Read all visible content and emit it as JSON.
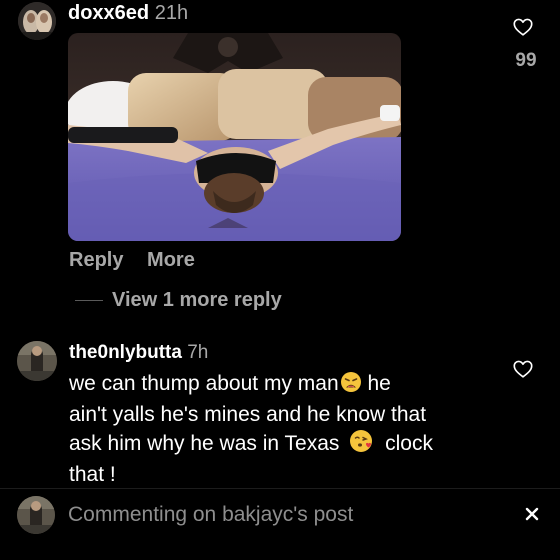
{
  "comments": [
    {
      "username": "doxx6ed",
      "time": "21h",
      "like_count": "99",
      "actions": {
        "reply": "Reply",
        "more": "More"
      },
      "view_replies": "View 1 more reply"
    },
    {
      "username": "the0nlybutta",
      "time": "7h",
      "text_lines": [
        "we can thump about my man",
        "he",
        "ain't yalls he's mines and he know that",
        "ask him why he was in Texas",
        "clock",
        "that !"
      ]
    }
  ],
  "composer": {
    "placeholder": "Commenting on bakjayc's post",
    "close_icon": "close-icon"
  },
  "colors": {
    "background": "#000000",
    "text": "#ffffff",
    "muted": "#a8a8a8"
  }
}
